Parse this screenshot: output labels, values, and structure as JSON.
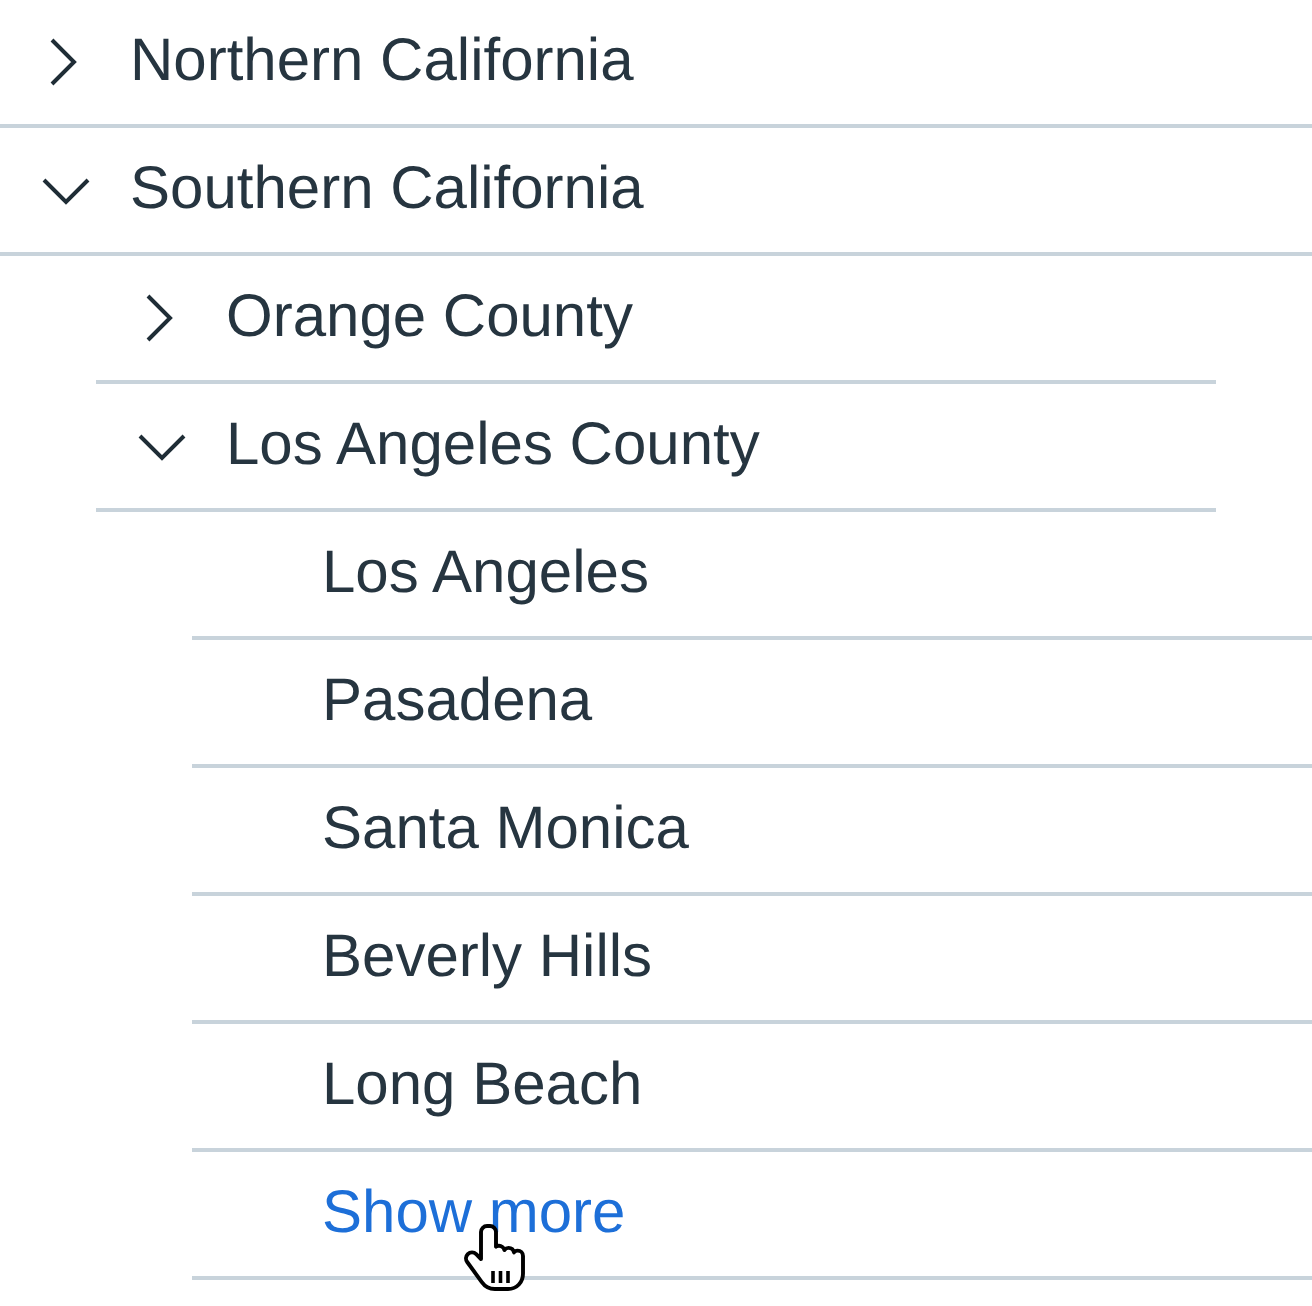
{
  "tree": [
    {
      "kind": "branch",
      "label": "Northern California",
      "expanded": false
    },
    {
      "kind": "branch",
      "label": "Southern California",
      "expanded": true,
      "children": [
        {
          "kind": "branch",
          "label": "Orange County",
          "expanded": false
        },
        {
          "kind": "branch",
          "label": "Los Angeles County",
          "expanded": true,
          "children": [
            {
              "kind": "leaf",
              "label": "Los Angeles"
            },
            {
              "kind": "leaf",
              "label": "Pasadena"
            },
            {
              "kind": "leaf",
              "label": "Santa Monica"
            },
            {
              "kind": "leaf",
              "label": "Beverly Hills"
            },
            {
              "kind": "leaf",
              "label": "Long Beach"
            },
            {
              "kind": "link",
              "label": "Show more"
            }
          ]
        }
      ]
    }
  ]
}
